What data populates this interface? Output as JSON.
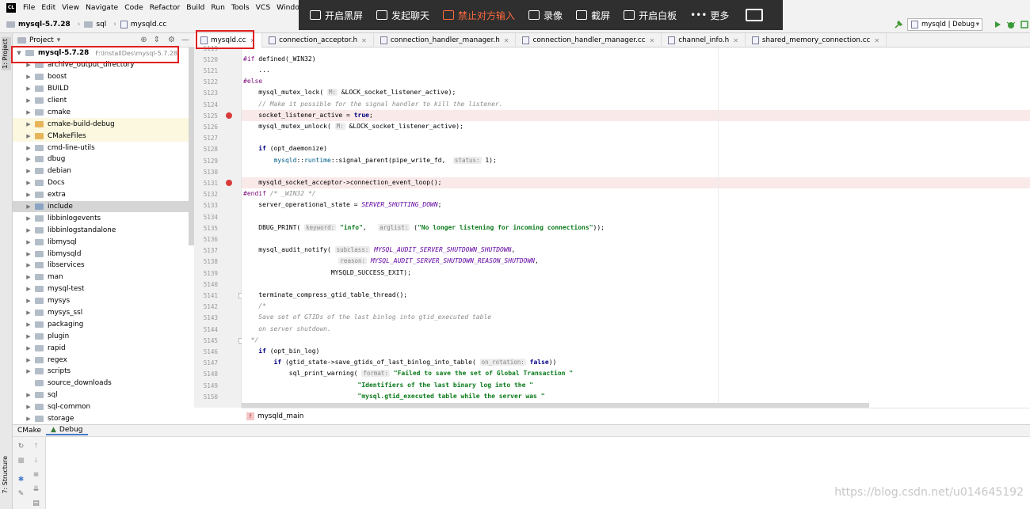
{
  "menu": [
    "File",
    "Edit",
    "View",
    "Navigate",
    "Code",
    "Refactor",
    "Build",
    "Run",
    "Tools",
    "VCS",
    "Window"
  ],
  "overlay": {
    "buttons": [
      "开启黑屏",
      "发起聊天",
      "禁止对方输入",
      "录像",
      "截屏",
      "开启白板",
      "更多"
    ],
    "active_index": 2
  },
  "breadcrumb": [
    "mysql-5.7.28",
    "sql",
    "mysqld.cc"
  ],
  "run_config": "mysqld | Debug",
  "project_panel": {
    "title": "Project"
  },
  "tree": {
    "root": {
      "name": "mysql-5.7.28",
      "path": "F:\\InstallDes\\mysql-5.7.28"
    },
    "items": [
      "archive_output_directory",
      "boost",
      "BUILD",
      "client",
      "cmake",
      "cmake-build-debug",
      "CMakeFiles",
      "cmd-line-utils",
      "dbug",
      "debian",
      "Docs",
      "extra",
      "include",
      "libbinlogevents",
      "libbinlogstandalone",
      "libmysql",
      "libmysqld",
      "libservices",
      "man",
      "mysql-test",
      "mysys",
      "mysys_ssl",
      "packaging",
      "plugin",
      "rapid",
      "regex",
      "scripts",
      "source_downloads",
      "sql",
      "sql-common",
      "storage"
    ]
  },
  "tabs": [
    "mysqld.cc",
    "connection_acceptor.h",
    "connection_handler_manager.h",
    "connection_handler_manager.cc",
    "channel_info.h",
    "shared_memory_connection.cc"
  ],
  "line_numbers": [
    "5119",
    "5120",
    "5121",
    "5122",
    "5123",
    "5124",
    "5125",
    "5126",
    "5127",
    "5128",
    "5129",
    "5130",
    "5131",
    "5132",
    "5133",
    "5134",
    "5135",
    "5136",
    "5137",
    "5138",
    "5139",
    "5140",
    "5141",
    "5142",
    "5143",
    "5144",
    "5145",
    "5146",
    "5147",
    "5148",
    "5149",
    "5150"
  ],
  "code_text": {
    "l5120a": "#if ",
    "l5120b": "defined(_WIN32)",
    "l5121": "    ...",
    "l5122": "#else",
    "l5123a": "    mysql_mutex_lock( ",
    "l5123h": "M:",
    "l5123b": " &LOCK_socket_listener_active);",
    "l5124": "    // Make it possible for the signal handler to kill the listener.",
    "l5125a": "    socket_listener_active = ",
    "l5125b": "true",
    "l5125c": ";",
    "l5126a": "    mysql_mutex_unlock( ",
    "l5126h": "M:",
    "l5126b": " &LOCK_socket_listener_active);",
    "l5128a": "    ",
    "l5128b": "if",
    "l5128c": " (opt_daemonize)",
    "l5129a": "        ",
    "l5129b": "mysqld",
    "l5129c": "::",
    "l5129d": "runtime",
    "l5129e": "::signal_parent(pipe_write_fd,  ",
    "l5129h": "status:",
    "l5129f": " 1);",
    "l5131": "    mysqld_socket_acceptor->connection_event_loop();",
    "l5132a": "#endif ",
    "l5132b": "/* _WIN32 */",
    "l5133a": "    server_operational_state = ",
    "l5133b": "SERVER_SHUTTING_DOWN",
    "l5133c": ";",
    "l5135a": "    DBUG_PRINT( ",
    "l5135h1": "keyword:",
    "l5135b": " ",
    "l5135s1": "\"info\"",
    "l5135c": ",   ",
    "l5135h2": "arglist:",
    "l5135d": " (",
    "l5135s2": "\"No longer listening for incoming connections\"",
    "l5135e": "));",
    "l5137a": "    mysql_audit_notify( ",
    "l5137h": "subclass:",
    "l5137b": " ",
    "l5137e": "MYSQL_AUDIT_SERVER_SHUTDOWN_SHUTDOWN",
    "l5137c": ",",
    "l5138a": "                         ",
    "l5138h": "reason:",
    "l5138b": " ",
    "l5138e": "MYSQL_AUDIT_SERVER_SHUTDOWN_REASON_SHUTDOWN",
    "l5138c": ",",
    "l5139": "                       MYSQLD_SUCCESS_EXIT);",
    "l5141": "    terminate_compress_gtid_table_thread();",
    "l5142": "    /*",
    "l5143": "    Save set of GTIDs of the last binlog into gtid_executed table",
    "l5144": "    on server shutdown.",
    "l5145": "  */",
    "l5146a": "    ",
    "l5146b": "if",
    "l5146c": " (opt_bin_log)",
    "l5147a": "        ",
    "l5147b": "if",
    "l5147c": " (gtid_state->save_gtids_of_last_binlog_into_table( ",
    "l5147h": "on_rotation:",
    "l5147d": " ",
    "l5147e": "false",
    "l5147f": "))",
    "l5148a": "            sql_print_warning( ",
    "l5148h": "format:",
    "l5148b": " ",
    "l5148s": "\"Failed to save the set of Global Transaction \"",
    "l5149a": "                              ",
    "l5149s": "\"Identifiers of the last binary log into the \"",
    "l5150a": "                              ",
    "l5150s": "\"mysql.gtid_executed table while the server was \""
  },
  "code_breadcrumb": {
    "badge": "f",
    "label": "mysqld_main"
  },
  "bottom_tabs": [
    "CMake",
    "Debug"
  ],
  "side_labels": {
    "project": "1: Project",
    "structure": "7: Structure"
  },
  "watermark": "https://blog.csdn.net/u014645192"
}
